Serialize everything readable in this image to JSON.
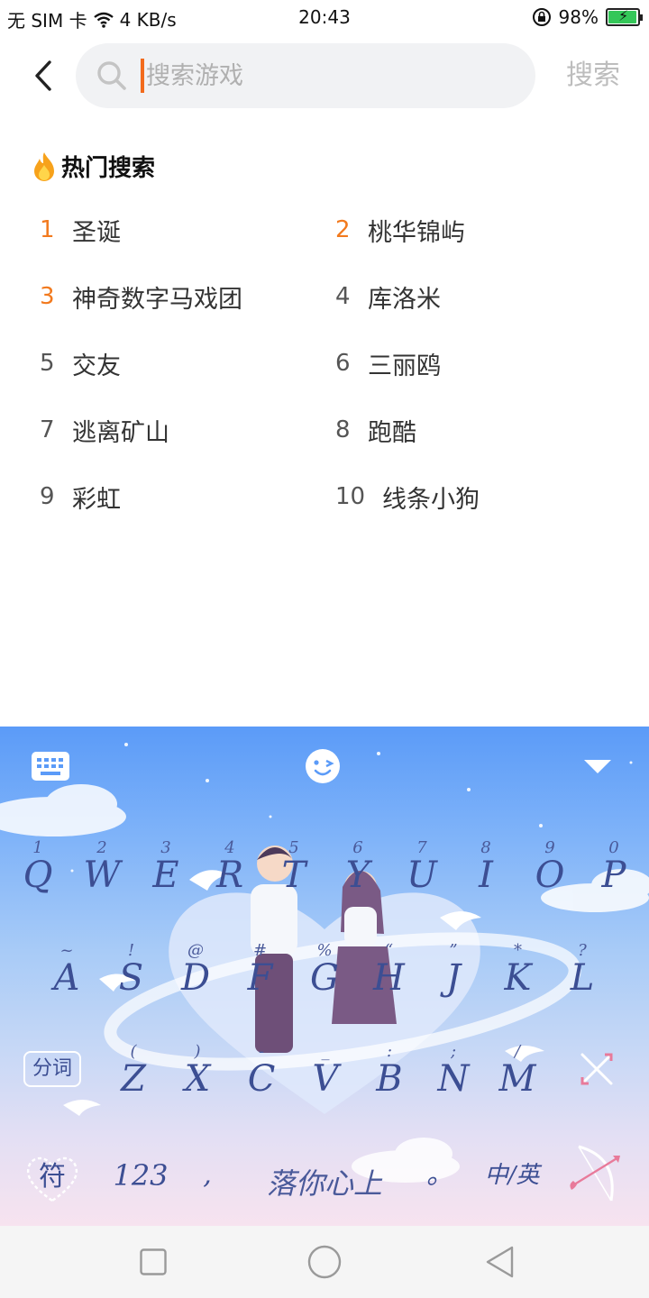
{
  "status_bar": {
    "carrier": "无 SIM 卡",
    "speed": "4 KB/s",
    "time": "20:43",
    "battery": "98%",
    "battery_level": 0.98
  },
  "search": {
    "placeholder": "搜索游戏",
    "value": "",
    "submit_label": "搜索"
  },
  "hot": {
    "title": "热门搜索",
    "items": [
      {
        "rank": "1",
        "label": "圣诞"
      },
      {
        "rank": "2",
        "label": "桃华锦屿"
      },
      {
        "rank": "3",
        "label": "神奇数字马戏团"
      },
      {
        "rank": "4",
        "label": "库洛米"
      },
      {
        "rank": "5",
        "label": "交友"
      },
      {
        "rank": "6",
        "label": "三丽鸥"
      },
      {
        "rank": "7",
        "label": "逃离矿山"
      },
      {
        "rank": "8",
        "label": "跑酷"
      },
      {
        "rank": "9",
        "label": "彩虹"
      },
      {
        "rank": "10",
        "label": "线条小狗"
      }
    ]
  },
  "keyboard": {
    "row1": [
      {
        "key": "Q",
        "sub": "1"
      },
      {
        "key": "W",
        "sub": "2"
      },
      {
        "key": "E",
        "sub": "3"
      },
      {
        "key": "R",
        "sub": "4"
      },
      {
        "key": "T",
        "sub": "5"
      },
      {
        "key": "Y",
        "sub": "6"
      },
      {
        "key": "U",
        "sub": "7"
      },
      {
        "key": "I",
        "sub": "8"
      },
      {
        "key": "O",
        "sub": "9"
      },
      {
        "key": "P",
        "sub": "0"
      }
    ],
    "row2": [
      {
        "key": "A",
        "sub": "~"
      },
      {
        "key": "S",
        "sub": "!"
      },
      {
        "key": "D",
        "sub": "@"
      },
      {
        "key": "F",
        "sub": "#"
      },
      {
        "key": "G",
        "sub": "%"
      },
      {
        "key": "H",
        "sub": "“"
      },
      {
        "key": "J",
        "sub": "”"
      },
      {
        "key": "K",
        "sub": "*"
      },
      {
        "key": "L",
        "sub": "?"
      }
    ],
    "row3": [
      {
        "key": "Z",
        "sub": "("
      },
      {
        "key": "X",
        "sub": ")"
      },
      {
        "key": "C",
        "sub": "-"
      },
      {
        "key": "V",
        "sub": "_"
      },
      {
        "key": "B",
        "sub": ":"
      },
      {
        "key": "N",
        "sub": ";"
      },
      {
        "key": "M",
        "sub": "/"
      }
    ],
    "fenci_label": "分词",
    "symbol_label": "符",
    "num_label": "123",
    "comma_label": ",",
    "space_label": "落你心上",
    "period_label": "。",
    "lang_label": "中/英"
  }
}
